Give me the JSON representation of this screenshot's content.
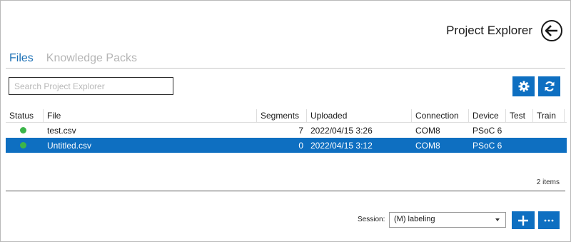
{
  "header": {
    "title": "Project Explorer",
    "back_icon": "arrow-left-icon"
  },
  "tabs": [
    {
      "label": "Files",
      "active": true
    },
    {
      "label": "Knowledge Packs",
      "active": false
    }
  ],
  "search": {
    "placeholder": "Search Project Explorer",
    "value": ""
  },
  "toolbar": {
    "settings_icon": "gear-icon",
    "refresh_icon": "refresh-icon"
  },
  "grid": {
    "columns": [
      "Status",
      "File",
      "Segments",
      "Uploaded",
      "Connection",
      "Device",
      "Test",
      "Train"
    ],
    "rows": [
      {
        "status_color": "#3cb54a",
        "file": "test.csv",
        "segments": "7",
        "uploaded": "2022/04/15 3:26",
        "connection": "COM8",
        "device": "PSoC 6 ",
        "test": "",
        "train": "",
        "selected": false
      },
      {
        "status_color": "#3cb54a",
        "file": "Untitled.csv",
        "segments": "0",
        "uploaded": "2022/04/15 3:12",
        "connection": "COM8",
        "device": "PSoC 6 ",
        "test": "",
        "train": "",
        "selected": true
      }
    ],
    "items_count": "2 items"
  },
  "session": {
    "label": "Session:",
    "value": "(M) labeling"
  },
  "actions": {
    "add_icon": "plus-icon",
    "more_icon": "ellipsis-icon"
  },
  "colors": {
    "accent": "#0e6fc1",
    "status_ok": "#3cb54a",
    "tab_inactive": "#b5b5b5"
  }
}
